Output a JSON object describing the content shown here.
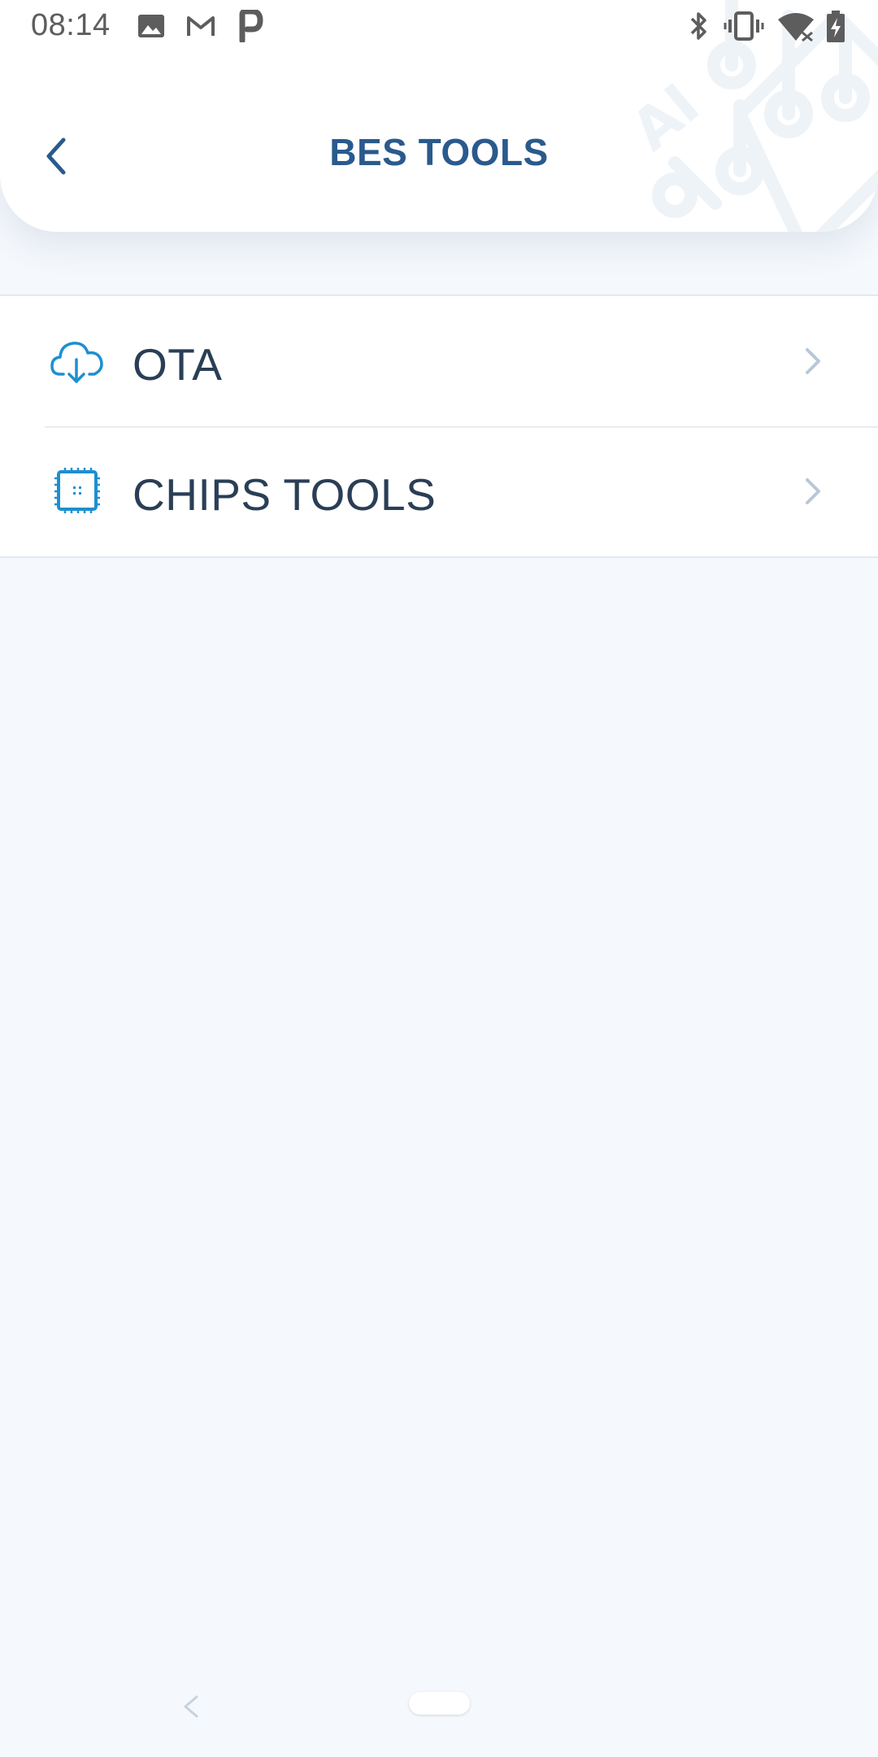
{
  "status_bar": {
    "time": "08:14",
    "left_icons": [
      "image-icon",
      "gmail-icon",
      "parking-icon"
    ],
    "right_icons": [
      "bluetooth-icon",
      "vibrate-icon",
      "wifi-no-internet-icon",
      "battery-charging-icon"
    ]
  },
  "header": {
    "title": "BES TOOLS",
    "back_icon": "chevron-left-icon",
    "decoration_text": "AI"
  },
  "menu": {
    "items": [
      {
        "label": "OTA",
        "icon": "cloud-download-icon",
        "chevron": "chevron-right-icon"
      },
      {
        "label": "CHIPS TOOLS",
        "icon": "chip-icon",
        "chevron": "chevron-right-icon"
      }
    ]
  },
  "nav_bar": {
    "back": "nav-back-icon",
    "home": "nav-home-pill"
  },
  "colors": {
    "title": "#2a5a8c",
    "icon_accent": "#1e8fd0",
    "label": "#2a3e56",
    "background": "#f5f8fc",
    "chevron": "#b8c7d8"
  }
}
